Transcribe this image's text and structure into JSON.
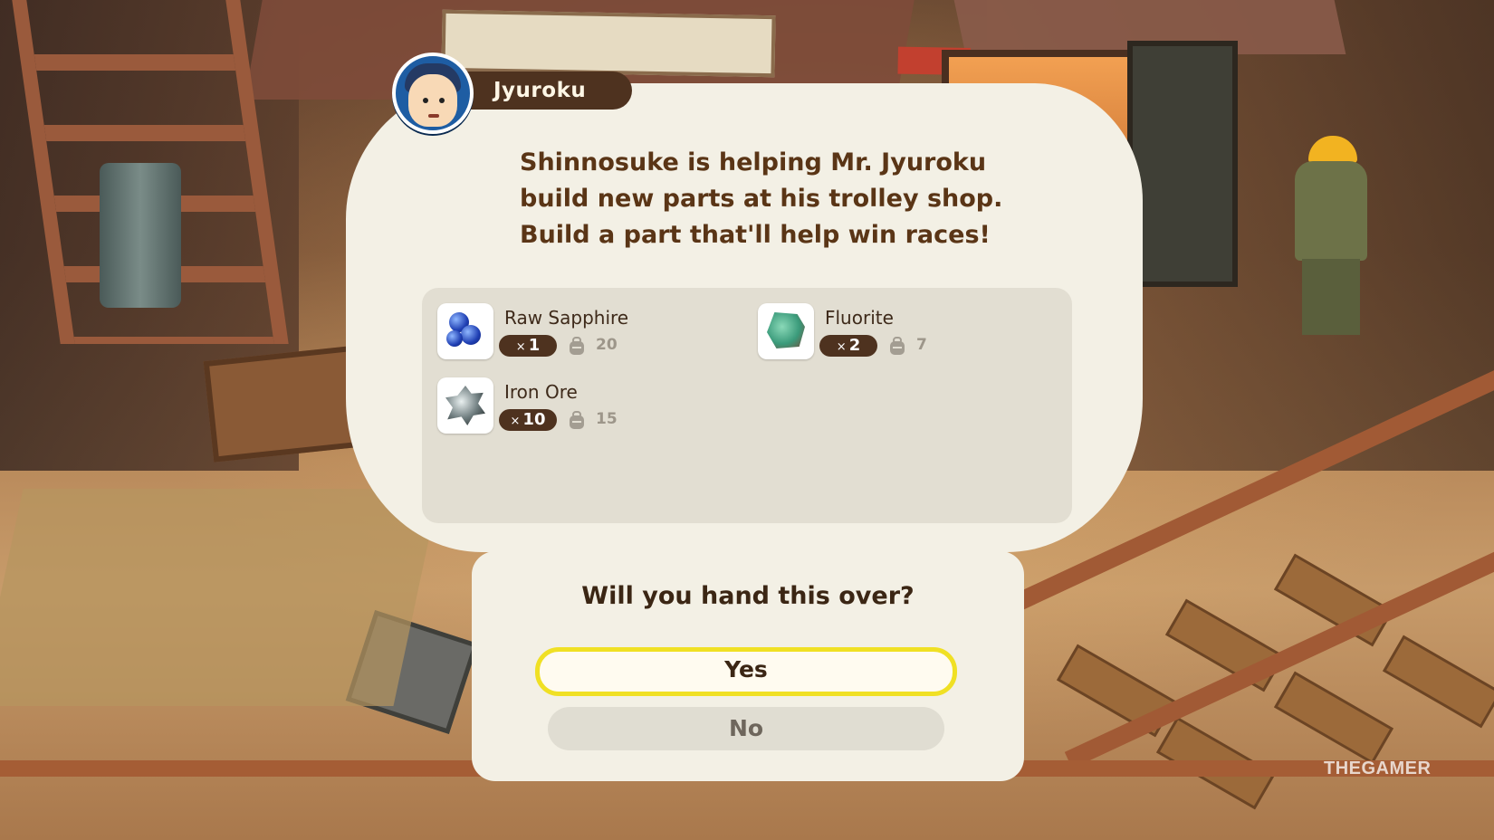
{
  "speaker": {
    "name": "Jyuroku",
    "avatar_icon": "jyuroku-portrait"
  },
  "message": {
    "lines": [
      "Shinnosuke is helping Mr. Jyuroku",
      "build new parts at his trolley shop.",
      "Build a part that'll help win races!"
    ]
  },
  "requirements": [
    {
      "name": "Raw Sapphire",
      "qty_prefix": "×",
      "qty": "1",
      "owned": "20",
      "icon": "raw-sapphire-icon"
    },
    {
      "name": "Fluorite",
      "qty_prefix": "×",
      "qty": "2",
      "owned": "7",
      "icon": "fluorite-icon"
    },
    {
      "name": "Iron Ore",
      "qty_prefix": "×",
      "qty": "10",
      "owned": "15",
      "icon": "iron-ore-icon"
    }
  ],
  "prompt": {
    "question": "Will you hand this over?",
    "yes_label": "Yes",
    "no_label": "No",
    "selected": "Yes"
  },
  "watermark": "THEGAMER",
  "colors": {
    "nameplate": "#4e321f",
    "dialog_bg": "#f3f0e5",
    "selection_outline": "#f0e024",
    "text_brown": "#5a3516"
  }
}
